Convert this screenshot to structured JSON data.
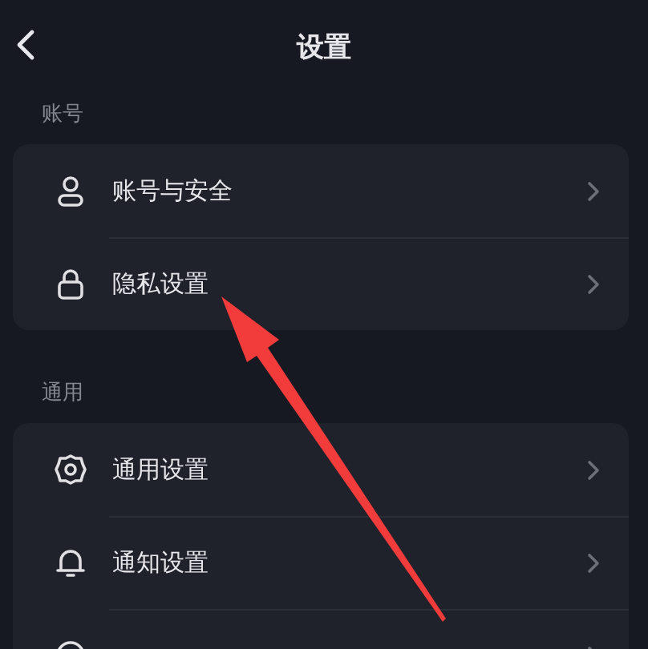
{
  "header": {
    "title": "设置"
  },
  "sections": [
    {
      "label": "账号",
      "items": [
        {
          "kind": "person",
          "label": "账号与安全"
        },
        {
          "kind": "lock",
          "label": "隐私设置"
        }
      ]
    },
    {
      "label": "通用",
      "items": [
        {
          "kind": "gear",
          "label": "通用设置"
        },
        {
          "kind": "bell",
          "label": "通知设置"
        },
        {
          "kind": "chat"
        }
      ]
    }
  ],
  "annotation": {
    "kind": "arrow"
  }
}
